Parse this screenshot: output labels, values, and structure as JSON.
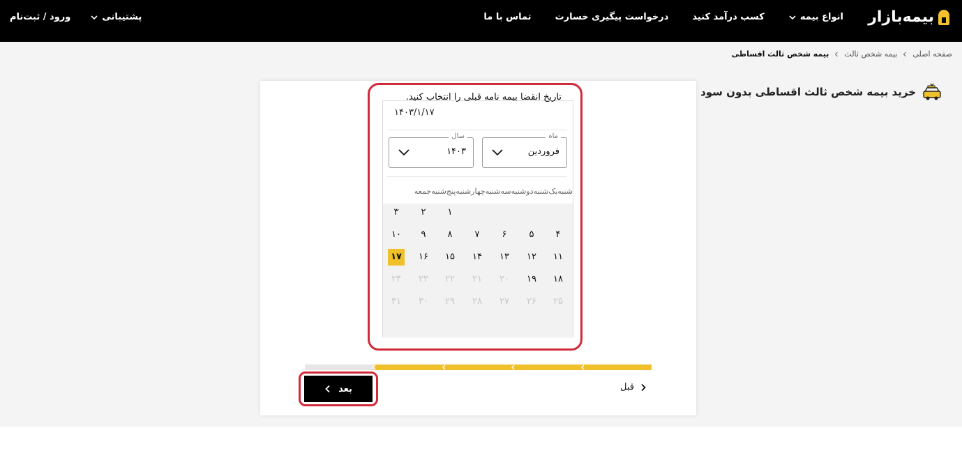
{
  "header": {
    "logo_text": "بیمه‌بازار",
    "nav": [
      {
        "label": "انواع بیمه",
        "has_dropdown": true
      },
      {
        "label": "کسب درآمد کنید",
        "has_dropdown": false
      },
      {
        "label": "درخواست پیگیری خسارت",
        "has_dropdown": false
      },
      {
        "label": "تماس با ما",
        "has_dropdown": false
      }
    ],
    "support_label": "پشتیبانی",
    "login_label": "ورود / ثبت‌نام"
  },
  "breadcrumb": [
    "صفحه اصلی",
    "بیمه شخص ثالث",
    "بیمه شخص ثالث اقساطی"
  ],
  "page_title": "خرید بیمه شخص ثالث اقساطی بدون سود",
  "form": {
    "field_label": "تاریخ انقضا بیمه نامه قبلی را انتخاب کنید.",
    "date_value": "۱۴۰۳/۱/۱۷",
    "month_select": {
      "legend": "ماه",
      "value": "فروردین"
    },
    "year_select": {
      "legend": "سال",
      "value": "۱۴۰۳"
    },
    "weekdays": [
      "شنبه",
      "یک‌شنبه",
      "دوشنبه",
      "سه‌شنبه",
      "چهارشنبه",
      "پنج‌شنبه",
      "جمعه"
    ],
    "weeks": [
      [
        "",
        "",
        "",
        "",
        "۱",
        "۲",
        "۳"
      ],
      [
        "۴",
        "۵",
        "۶",
        "۷",
        "۸",
        "۹",
        "۱۰"
      ],
      [
        "۱۱",
        "۱۲",
        "۱۳",
        "۱۴",
        "۱۵",
        "۱۶",
        "۱۷"
      ],
      [
        "۱۸",
        "۱۹",
        "۲۰",
        "۲۱",
        "۲۲",
        "۲۳",
        "۲۴"
      ],
      [
        "۲۵",
        "۲۶",
        "۲۷",
        "۲۸",
        "۲۹",
        "۳۰",
        "۳۱"
      ]
    ],
    "selected_day": "۱۷",
    "last_enabled_day": 19,
    "progress": {
      "steps": 5,
      "completed": 4
    },
    "next_label": "بعد",
    "prev_label": "قبل"
  },
  "colors": {
    "accent": "#efc02a",
    "header_bg": "#000000",
    "highlight": "#d12a3a"
  }
}
